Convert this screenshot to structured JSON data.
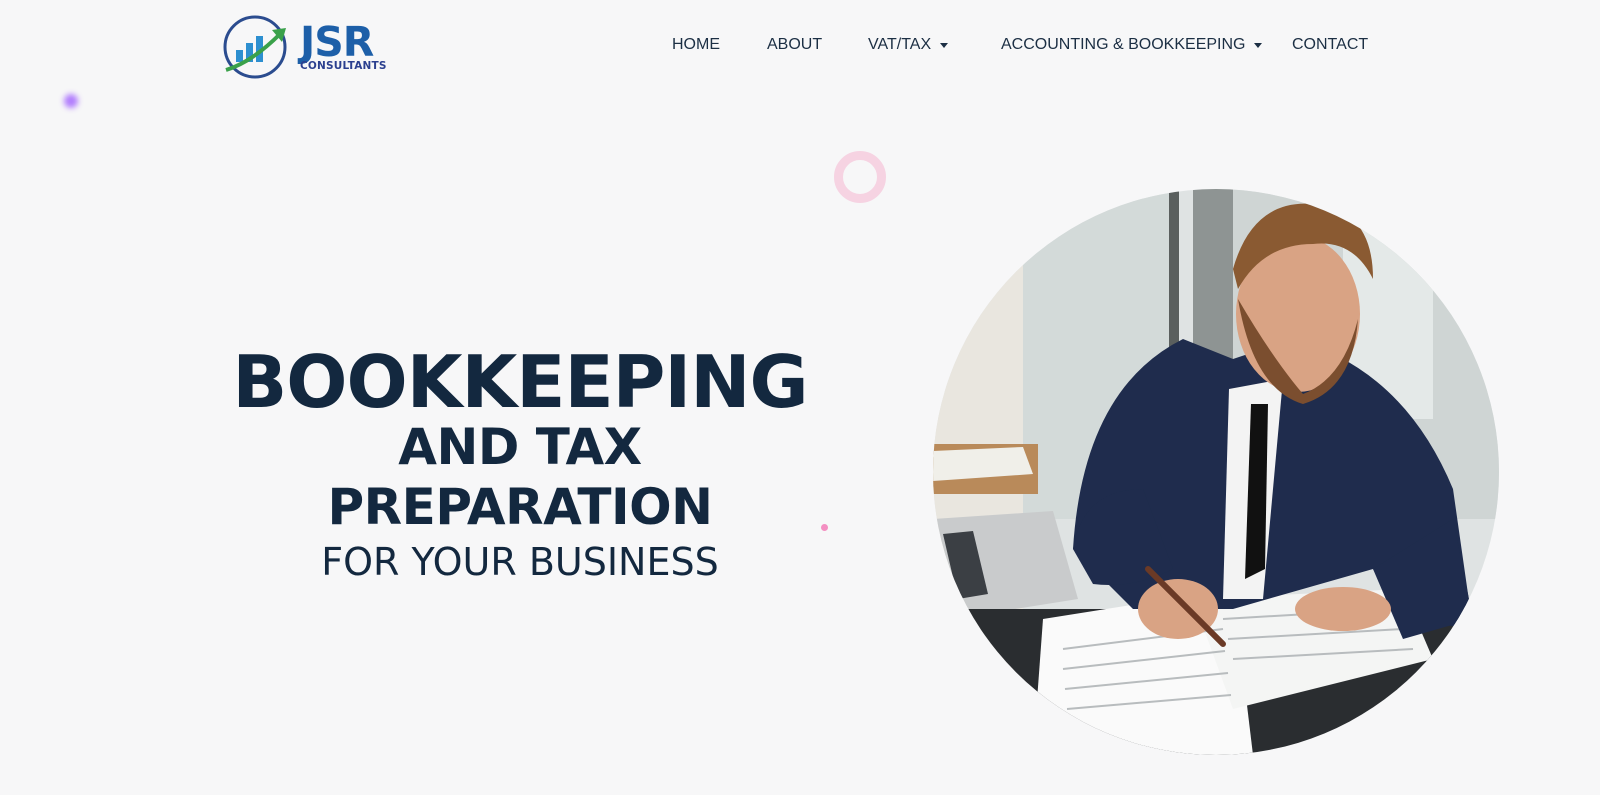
{
  "brand": {
    "name": "JSR",
    "tagline": "CONSULTANTS",
    "colors": {
      "primary": "#1d5fa8",
      "green": "#3aa14a",
      "dark": "#13283f"
    }
  },
  "nav": {
    "items": [
      {
        "label": "HOME"
      },
      {
        "label": "ABOUT"
      },
      {
        "label": "VAT/TAX",
        "dropdown": true
      },
      {
        "label": "ACCOUNTING & BOOKKEEPING",
        "dropdown": true
      },
      {
        "label": "CONTACT"
      }
    ]
  },
  "hero": {
    "line1": "BOOKKEEPING",
    "line2": "AND TAX",
    "line3": "PREPARATION",
    "line4": "FOR YOUR BUSINESS"
  }
}
